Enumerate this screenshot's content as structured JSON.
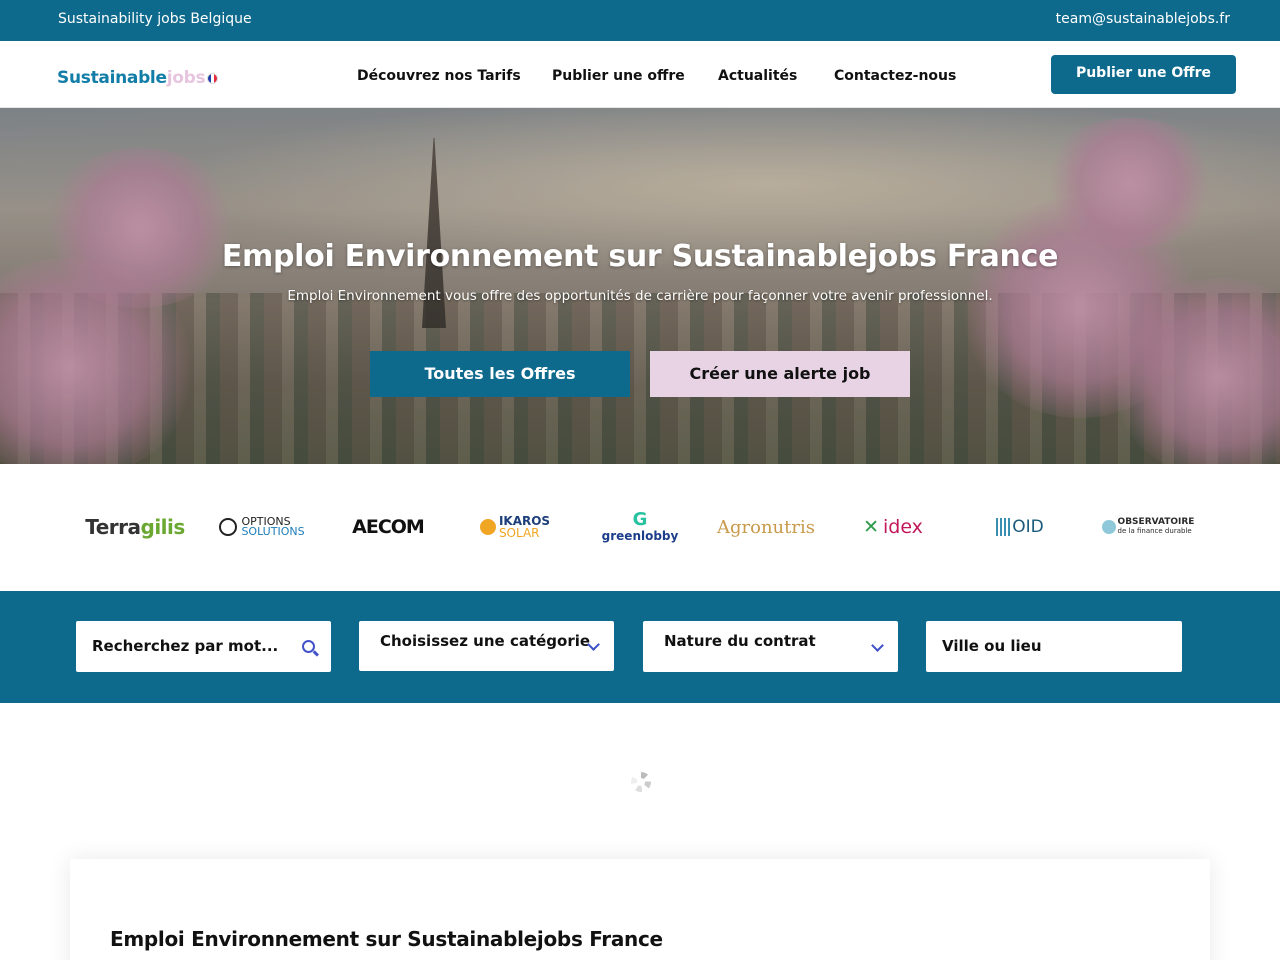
{
  "topbar": {
    "left_text": "Sustainability jobs Belgique",
    "email": "team@sustainablejobs.fr"
  },
  "header": {
    "logo_part1": "Sustainable",
    "logo_part2": "jobs",
    "logo_flag": "france-flag-icon",
    "menu": [
      {
        "label": "Découvrez nos Tarifs"
      },
      {
        "label": "Publier une offre"
      },
      {
        "label": "Actualités"
      },
      {
        "label": "Contactez-nous"
      }
    ],
    "cta_label": "Publier une Offre"
  },
  "hero": {
    "title": "Emploi Environnement sur Sustainablejobs France",
    "subtitle": "Emploi Environnement vous offre des opportunités de carrière pour façonner votre avenir professionnel.",
    "button_primary": "Toutes les Offres",
    "button_secondary": "Créer une alerte job"
  },
  "partners": [
    {
      "name": "Terragilis",
      "part_a": "Terra",
      "part_b": "gilis"
    },
    {
      "name": "OPTIONS SOLUTIONS",
      "part_a": "OPTIONS",
      "part_b": "SOLUTIONS"
    },
    {
      "name": "AECOM"
    },
    {
      "name": "IKAROS SOLAR",
      "part_a": "IKAROS",
      "part_b": "SOLAR"
    },
    {
      "name": "greenlobby"
    },
    {
      "name": "Agronutris"
    },
    {
      "name": "idex"
    },
    {
      "name": "OID"
    },
    {
      "name": "OBSERVATOIRE de la finance durable",
      "part_a": "OBSERVATOIRE",
      "part_b": "de la finance durable"
    }
  ],
  "search": {
    "keyword_placeholder": "Recherchez par mot...",
    "category_placeholder": "Choisissez une catégorie",
    "contract_placeholder": "Nature du contrat",
    "location_placeholder": "Ville ou lieu"
  },
  "content": {
    "heading": "Emploi Environnement sur Sustainablejobs France"
  },
  "colors": {
    "primary": "#0e6a8c",
    "accent_pink": "#e8d3e5",
    "icon_blue": "#4452c9"
  }
}
